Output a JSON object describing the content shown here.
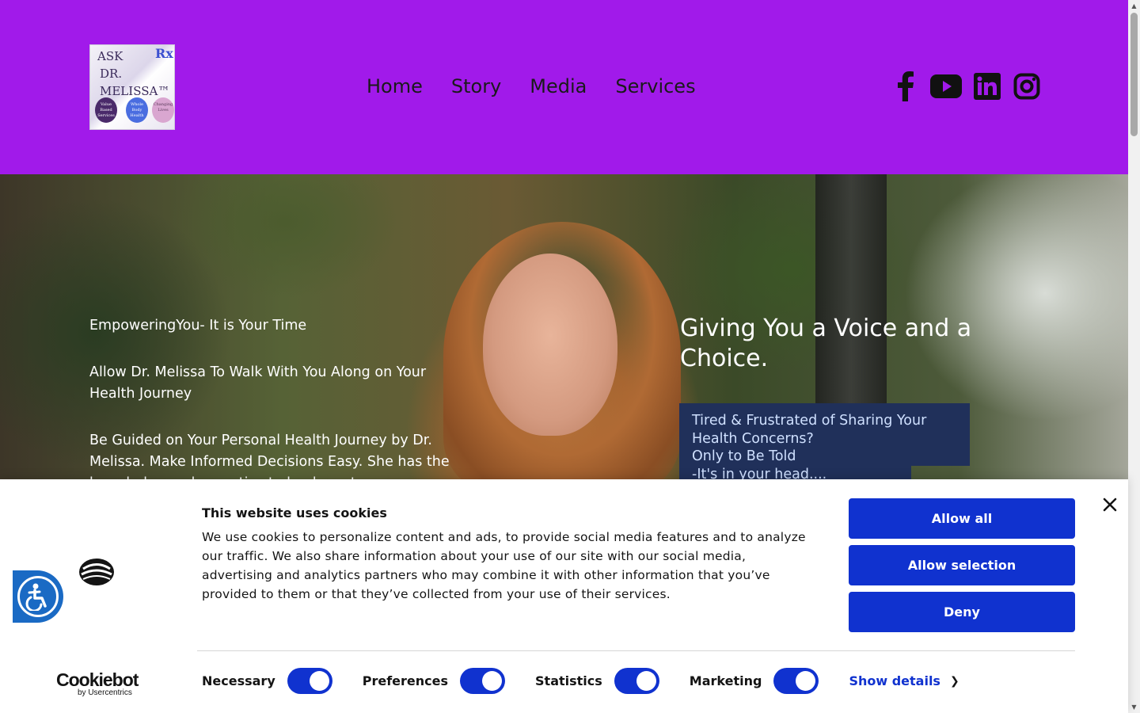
{
  "header": {
    "logo": {
      "line1": "ASK",
      "line2": "DR.",
      "line3": "MELISSA™",
      "rx": "Rx",
      "circles": [
        "Value Based Services",
        "Whole Body Health",
        "Changing Lives"
      ]
    },
    "nav": [
      "Home",
      "Story",
      "Media",
      "Services"
    ],
    "social_icons": [
      "facebook-icon",
      "youtube-icon",
      "linkedin-icon",
      "instagram-icon"
    ],
    "background": "#a11aea"
  },
  "hero": {
    "left": {
      "p1": "EmpoweringYou- It is Your Time",
      "p2": "Allow Dr. Melissa To Walk With You Along on Your Health Journey",
      "p3": "Be Guided on Your Personal Health Journey by Dr. Melissa. Make Informed Decisions Easy. She has the knowledge and expertise to lead you to"
    },
    "title": "Giving You a Voice and a Choice.",
    "box_lines": [
      "Tired & Frustrated of Sharing Your Health Concerns?",
      "Only to Be Told",
      "-It's in your head...."
    ],
    "box_color": "#20305a"
  },
  "cookie": {
    "title": "This website uses cookies",
    "text": "We use cookies to personalize content and ads, to provide social media features and to analyze our traffic. We also share information about your use of our site with our social media, advertising and analytics partners who may combine it with other information that you’ve provided to them or that they’ve collected from your use of their services.",
    "buttons": {
      "allow_all": "Allow all",
      "allow_selection": "Allow selection",
      "deny": "Deny"
    },
    "toggles": [
      {
        "label": "Necessary",
        "on": true
      },
      {
        "label": "Preferences",
        "on": true
      },
      {
        "label": "Statistics",
        "on": true
      },
      {
        "label": "Marketing",
        "on": true
      }
    ],
    "show_details": "Show details",
    "brand": {
      "name": "Cookiebot",
      "sub": "by Usercentrics"
    },
    "accent": "#1032cf"
  }
}
